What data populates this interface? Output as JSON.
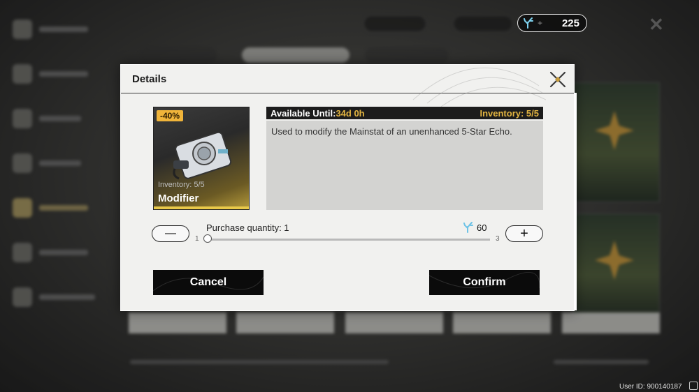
{
  "header": {
    "currency": {
      "icon": "coral-icon",
      "plus": "+",
      "value": "225"
    }
  },
  "modal": {
    "title": "Details",
    "item": {
      "discount": "-40%",
      "inventory": "Inventory: 5/5",
      "name": "Modifier"
    },
    "info": {
      "available_label": "Available Until:",
      "available_value": "34d 0h",
      "inventory": "Inventory: 5/5",
      "description": "Used to modify the Mainstat of an unenhanced 5-Star Echo."
    },
    "purchase": {
      "label": "Purchase quantity: 1",
      "quantity": 1,
      "cost": "60",
      "min": "1",
      "max": "3",
      "minus": "—",
      "plus": "+"
    },
    "buttons": {
      "cancel": "Cancel",
      "confirm": "Confirm"
    }
  },
  "footer": {
    "user_id": "User ID: 900140187"
  },
  "colors": {
    "accent_gold": "#e2b441",
    "coral_blue": "#6ec3e6",
    "modal_bg": "#f1f1ef"
  }
}
